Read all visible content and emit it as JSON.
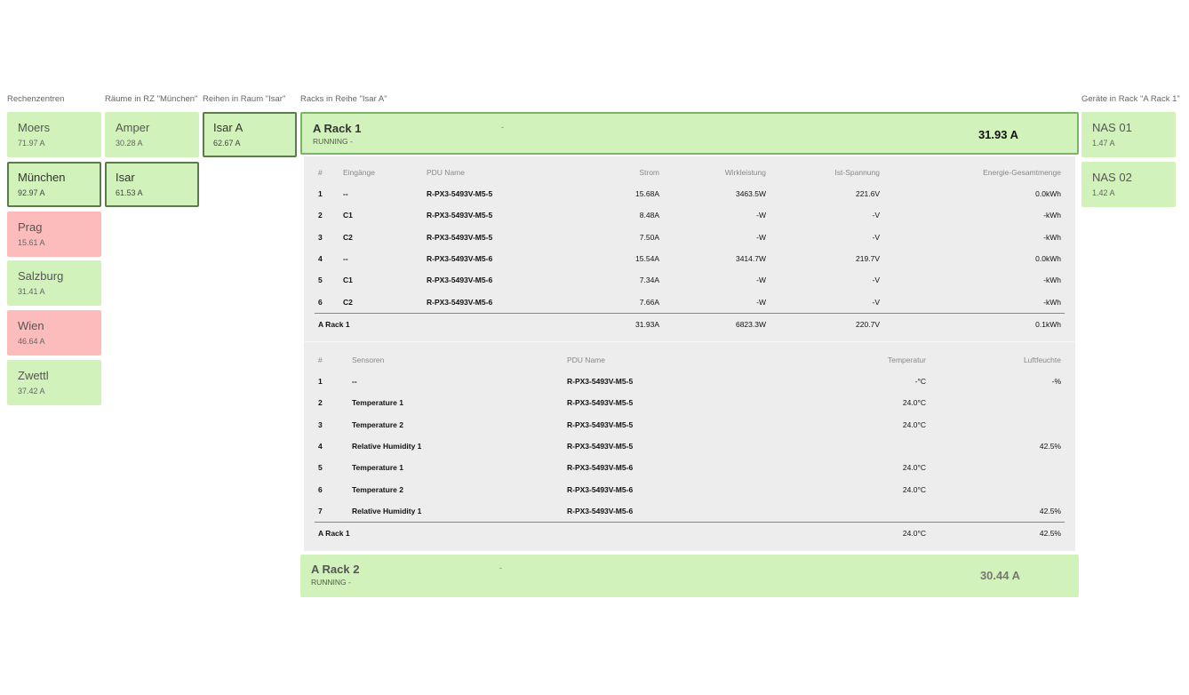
{
  "headers": {
    "datacenters": "Rechenzentren",
    "rooms": "Räume in RZ \"München\"",
    "rows": "Reihen in Raum \"Isar\"",
    "racks": "Racks in Reihe \"Isar A\"",
    "devices": "Geräte in Rack \"A Rack 1\""
  },
  "datacenters": [
    {
      "name": "Moers",
      "current": "71.97 A"
    },
    {
      "name": "München",
      "current": "92.97 A"
    },
    {
      "name": "Prag",
      "current": "15.61 A"
    },
    {
      "name": "Salzburg",
      "current": "31.41 A"
    },
    {
      "name": "Wien",
      "current": "46.64 A"
    },
    {
      "name": "Zwettl",
      "current": "37.42 A"
    }
  ],
  "rooms": [
    {
      "name": "Amper",
      "current": "30.28 A"
    },
    {
      "name": "Isar",
      "current": "61.53 A"
    }
  ],
  "rows": [
    {
      "name": "Isar A",
      "current": "62.67 A"
    }
  ],
  "devices": [
    {
      "name": "NAS 01",
      "current": "1.47 A"
    },
    {
      "name": "NAS 02",
      "current": "1.42 A"
    }
  ],
  "racks": [
    {
      "name": "A Rack 1",
      "status": "RUNNING -",
      "dash": "-",
      "current": "31.93 A"
    },
    {
      "name": "A Rack 2",
      "status": "RUNNING -",
      "dash": "-",
      "current": "30.44 A"
    }
  ],
  "inputs_table": {
    "headers": [
      "#",
      "Eingänge",
      "PDU Name",
      "Strom",
      "Wirkleistung",
      "Ist-Spannung",
      "Energie-Gesamtmenge"
    ],
    "rows": [
      [
        "1",
        "--",
        "R-PX3-5493V-M5-5",
        "15.68A",
        "3463.5W",
        "221.6V",
        "0.0kWh"
      ],
      [
        "2",
        "C1",
        "R-PX3-5493V-M5-5",
        "8.48A",
        "-W",
        "-V",
        "-kWh"
      ],
      [
        "3",
        "C2",
        "R-PX3-5493V-M5-5",
        "7.50A",
        "-W",
        "-V",
        "-kWh"
      ],
      [
        "4",
        "--",
        "R-PX3-5493V-M5-6",
        "15.54A",
        "3414.7W",
        "219.7V",
        "0.0kWh"
      ],
      [
        "5",
        "C1",
        "R-PX3-5493V-M5-6",
        "7.34A",
        "-W",
        "-V",
        "-kWh"
      ],
      [
        "6",
        "C2",
        "R-PX3-5493V-M5-6",
        "7.66A",
        "-W",
        "-V",
        "-kWh"
      ]
    ],
    "total": [
      "A Rack 1",
      "",
      "",
      "31.93A",
      "6823.3W",
      "220.7V",
      "0.1kWh"
    ]
  },
  "sensors_table": {
    "headers": [
      "#",
      "Sensoren",
      "PDU Name",
      "Temperatur",
      "Luftfeuchte"
    ],
    "rows": [
      [
        "1",
        "--",
        "R-PX3-5493V-M5-5",
        "-°C",
        "-%"
      ],
      [
        "2",
        "Temperature 1",
        "R-PX3-5493V-M5-5",
        "24.0°C",
        ""
      ],
      [
        "3",
        "Temperature 2",
        "R-PX3-5493V-M5-5",
        "24.0°C",
        ""
      ],
      [
        "4",
        "Relative Humidity 1",
        "R-PX3-5493V-M5-5",
        "",
        "42.5%"
      ],
      [
        "5",
        "Temperature 1",
        "R-PX3-5493V-M5-6",
        "24.0°C",
        ""
      ],
      [
        "6",
        "Temperature 2",
        "R-PX3-5493V-M5-6",
        "24.0°C",
        ""
      ],
      [
        "7",
        "Relative Humidity 1",
        "R-PX3-5493V-M5-6",
        "",
        "42.5%"
      ]
    ],
    "total": [
      "A Rack 1",
      "",
      "",
      "24.0°C",
      "42.5%"
    ]
  },
  "colors": {
    "ok": "#d2f2bb",
    "alarm": "#fdbcbc",
    "selected_border": "#5c7a4e",
    "rack_selected_border": "#7ab369",
    "detail_bg": "#ededed"
  }
}
